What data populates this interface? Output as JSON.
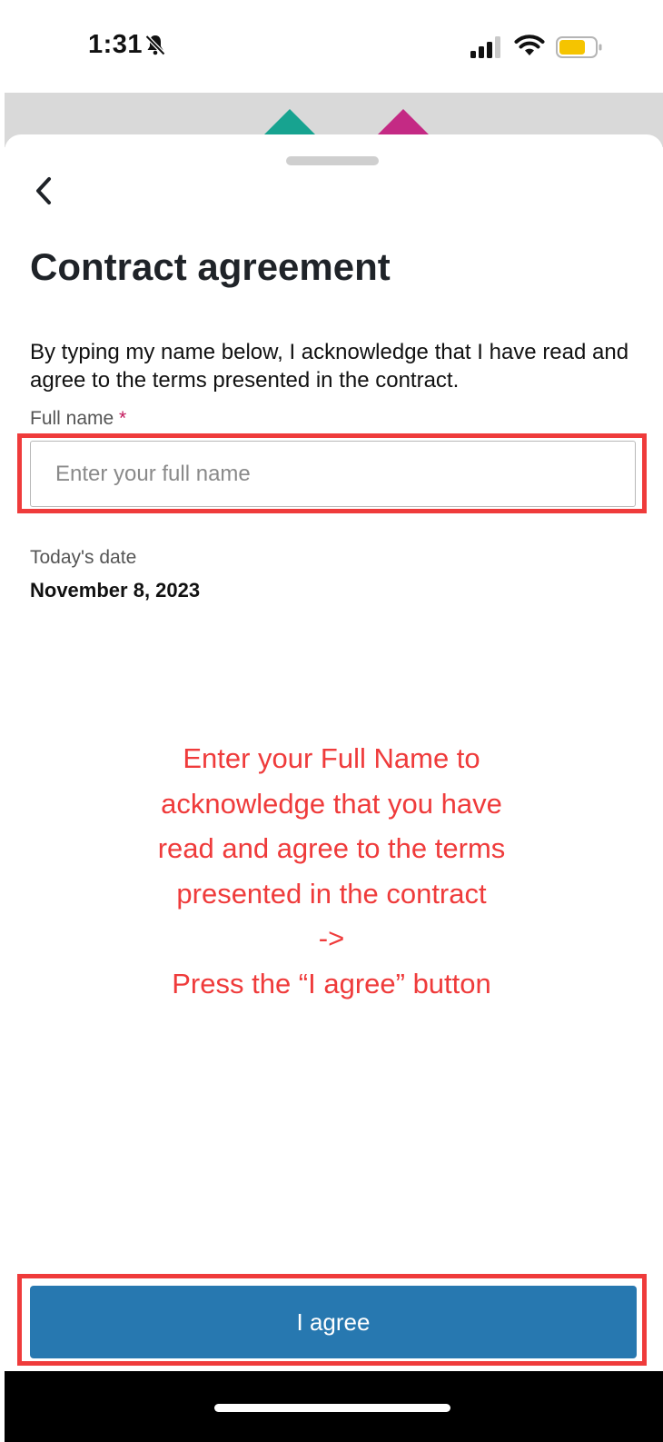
{
  "status_bar": {
    "time": "1:31",
    "icons": [
      "bell-slash-icon",
      "cellular-signal-icon",
      "wifi-icon",
      "battery-icon"
    ],
    "battery_color": "#f5c400"
  },
  "backdrop": {
    "shape_colors": [
      "#17a390",
      "#c42a84"
    ]
  },
  "sheet": {
    "back_icon": "chevron-left-icon",
    "title": "Contract agreement",
    "description": "By typing my name below, I acknowledge that I have read and agree to the terms presented in the contract.",
    "full_name": {
      "label": "Full name",
      "required_mark": "*",
      "placeholder": "Enter your full name",
      "value": ""
    },
    "date": {
      "label": "Today's date",
      "value": "November 8, 2023"
    },
    "agree_button": "I agree"
  },
  "annotation": {
    "lines": [
      "Enter your Full Name to",
      "acknowledge that you have",
      "read and agree to the terms",
      "presented in the contract",
      "->",
      "Press the “I agree” button"
    ],
    "color": "#ef3b3b"
  },
  "colors": {
    "primary_button": "#2778b0",
    "highlight": "#ef3b3b",
    "required": "#c2185b"
  }
}
